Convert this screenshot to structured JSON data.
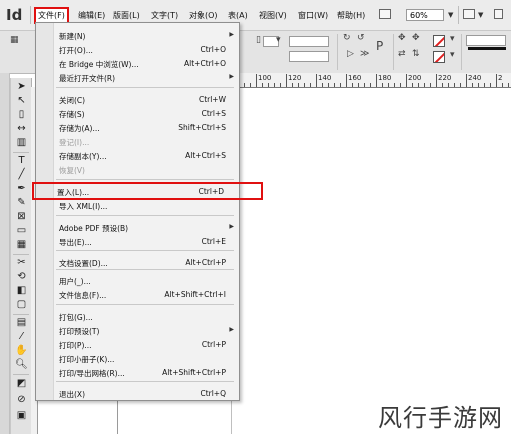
{
  "app": {
    "logo": "Id"
  },
  "menubar": {
    "items": [
      {
        "label": "文件(F)",
        "active": true
      },
      {
        "label": "编辑(E)"
      },
      {
        "label": "版面(L)"
      },
      {
        "label": "文字(T)"
      },
      {
        "label": "对象(O)"
      },
      {
        "label": "表(A)"
      },
      {
        "label": "视图(V)"
      },
      {
        "label": "窗口(W)"
      },
      {
        "label": "帮助(H)"
      }
    ],
    "zoom": "60%"
  },
  "ruler": {
    "ticks": [
      "100",
      "120",
      "140",
      "160",
      "180",
      "200",
      "220",
      "240",
      "2"
    ]
  },
  "file_menu": {
    "items": [
      {
        "label": "新建(N)",
        "shortcut": "",
        "submenu": true
      },
      {
        "label": "打开(O)...",
        "shortcut": "Ctrl+O"
      },
      {
        "label": "在 Bridge 中浏览(W)...",
        "shortcut": "Alt+Ctrl+O"
      },
      {
        "label": "最近打开文件(R)",
        "shortcut": "",
        "submenu": true
      },
      {
        "label": "关闭(C)",
        "shortcut": "Ctrl+W"
      },
      {
        "label": "存储(S)",
        "shortcut": "Ctrl+S"
      },
      {
        "label": "存储为(A)...",
        "shortcut": "Shift+Ctrl+S"
      },
      {
        "label": "登记(I)...",
        "shortcut": "",
        "disabled": true
      },
      {
        "label": "存储副本(Y)...",
        "shortcut": "Alt+Ctrl+S"
      },
      {
        "label": "恢复(V)",
        "shortcut": "",
        "disabled": true
      },
      {
        "label": "置入(L)...",
        "shortcut": "Ctrl+D",
        "highlighted": true
      },
      {
        "label": "导入 XML(I)...",
        "shortcut": ""
      },
      {
        "label": "Adobe PDF 预设(B)",
        "shortcut": "",
        "submenu": true
      },
      {
        "label": "导出(E)...",
        "shortcut": "Ctrl+E"
      },
      {
        "label": "文档设置(D)...",
        "shortcut": "Alt+Ctrl+P"
      },
      {
        "label": "用户(_)...",
        "shortcut": ""
      },
      {
        "label": "文件信息(F)...",
        "shortcut": "Alt+Shift+Ctrl+I"
      },
      {
        "label": "打包(G)...",
        "shortcut": ""
      },
      {
        "label": "打印预设(T)",
        "shortcut": "",
        "submenu": true
      },
      {
        "label": "打印(P)...",
        "shortcut": "Ctrl+P"
      },
      {
        "label": "打印小册子(K)...",
        "shortcut": ""
      },
      {
        "label": "打印/导出网格(R)...",
        "shortcut": "Alt+Shift+Ctrl+P"
      },
      {
        "label": "退出(X)",
        "shortcut": "Ctrl+Q"
      }
    ]
  },
  "watermark": "风行手游网"
}
